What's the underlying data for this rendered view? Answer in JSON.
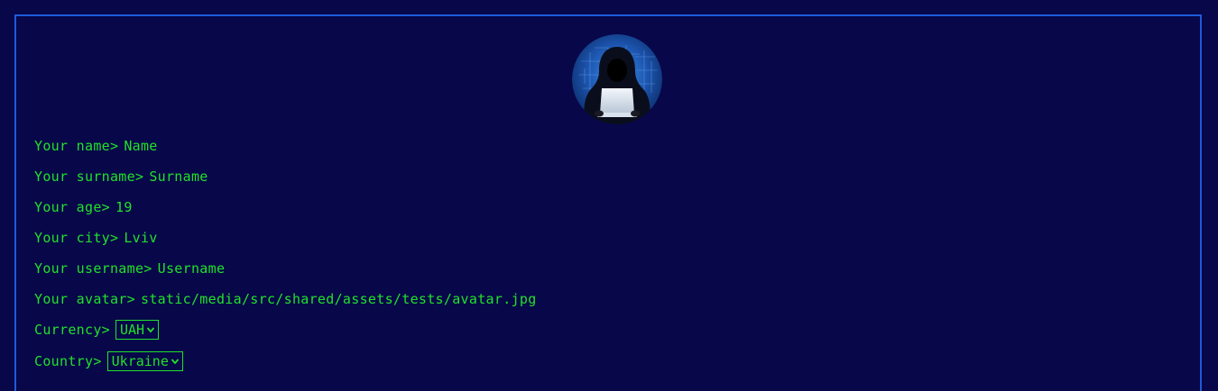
{
  "profile": {
    "avatar": {
      "icon": "hooded-hacker-avatar"
    },
    "fields": [
      {
        "label": "Your name>",
        "value": "Name"
      },
      {
        "label": "Your surname>",
        "value": "Surname"
      },
      {
        "label": "Your age>",
        "value": "19"
      },
      {
        "label": "Your city>",
        "value": "Lviv"
      },
      {
        "label": "Your username>",
        "value": "Username"
      },
      {
        "label": "Your avatar>",
        "value": "static/media/src/shared/assets/tests/avatar.jpg"
      }
    ],
    "currency": {
      "label": "Currency>",
      "selected": "UAH"
    },
    "country": {
      "label": "Country>",
      "selected": "Ukraine"
    }
  },
  "colors": {
    "background": "#07074a",
    "border": "#1f5ad8",
    "text": "#22e02a"
  }
}
